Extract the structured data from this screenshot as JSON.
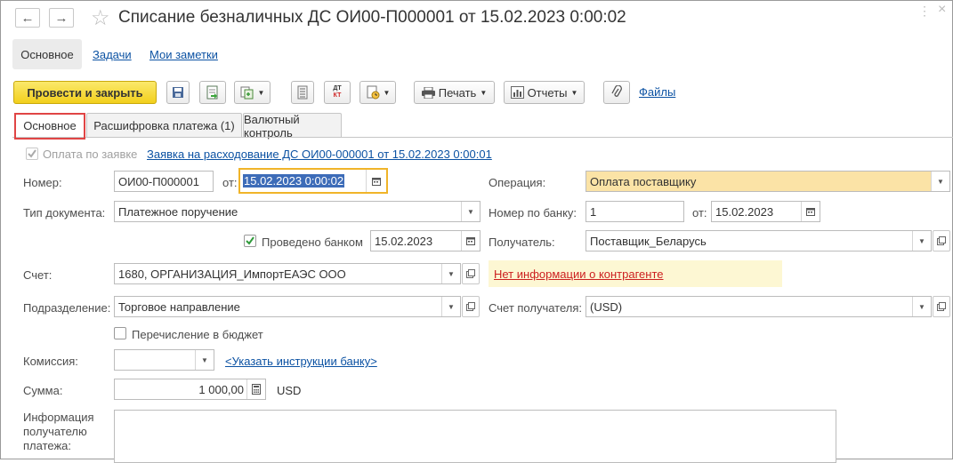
{
  "window": {
    "title": "Списание безналичных ДС ОИ00-П000001 от 15.02.2023 0:00:02",
    "back_icon": "←",
    "forward_icon": "→",
    "star_icon": "☆",
    "more_icon": "⋮",
    "close_icon": "×"
  },
  "nav": {
    "main_label": "Основное",
    "tasks_label": "Задачи",
    "notes_label": "Мои заметки"
  },
  "toolbar": {
    "post_close_label": "Провести и закрыть",
    "print_label": "Печать",
    "reports_label": "Отчеты",
    "files_label": "Файлы",
    "dtkt_top": "ДТ",
    "dtkt_bottom": "КТ"
  },
  "tabs": [
    {
      "label": "Основное",
      "active": true
    },
    {
      "label": "Расшифровка платежа (1)",
      "active": false
    },
    {
      "label": "Валютный контроль",
      "active": false
    }
  ],
  "form": {
    "pay_by_request_label": "Оплата по заявке",
    "request_link": "Заявка на расходование ДС ОИ00-000001 от 15.02.2023 0:00:01",
    "number_label": "Номер:",
    "number_value": "ОИ00-П000001",
    "from_label": "от:",
    "date_value": "15.02.2023  0:00:02",
    "operation_label": "Операция:",
    "operation_value": "Оплата поставщику",
    "doctype_label": "Тип документа:",
    "doctype_value": "Платежное поручение",
    "bank_number_label": "Номер по банку:",
    "bank_number_value": "1",
    "bank_from_label": "от:",
    "bank_date_value": "15.02.2023",
    "bank_posted_label": "Проведено банком",
    "bank_posted_checked": true,
    "bank_posted_date": "15.02.2023",
    "recipient_label": "Получатель:",
    "recipient_value": "Поставщик_Беларусь",
    "account_label": "Счет:",
    "account_value": "1680, ОРГАНИЗАЦИЯ_ИмпортЕАЭС ООО",
    "no_info_link": "Нет информации о контрагенте",
    "division_label": "Подразделение:",
    "division_value": "Торговое направление",
    "recipient_account_label": "Счет получателя:",
    "recipient_account_value": "(USD)",
    "budget_transfer_label": "Перечисление в бюджет",
    "budget_transfer_checked": false,
    "commission_label": "Комиссия:",
    "commission_value": "",
    "bank_instructions_link": "<Указать инструкции банку>",
    "sum_label": "Сумма:",
    "sum_value": "1 000,00",
    "currency": "USD",
    "recipient_info_label_1": "Информация",
    "recipient_info_label_2": "получателю",
    "recipient_info_label_3": "платежа:",
    "recipient_info_value": ""
  },
  "colors": {
    "accent_yellow": "#f2cf1c",
    "highlight_box": "#e04545",
    "date_focus": "#f0b429",
    "operation_bg": "#fbe3a6",
    "warning_bg": "#fdf7d3",
    "warning_text": "#cc1f1f",
    "link": "#0c52a3"
  }
}
